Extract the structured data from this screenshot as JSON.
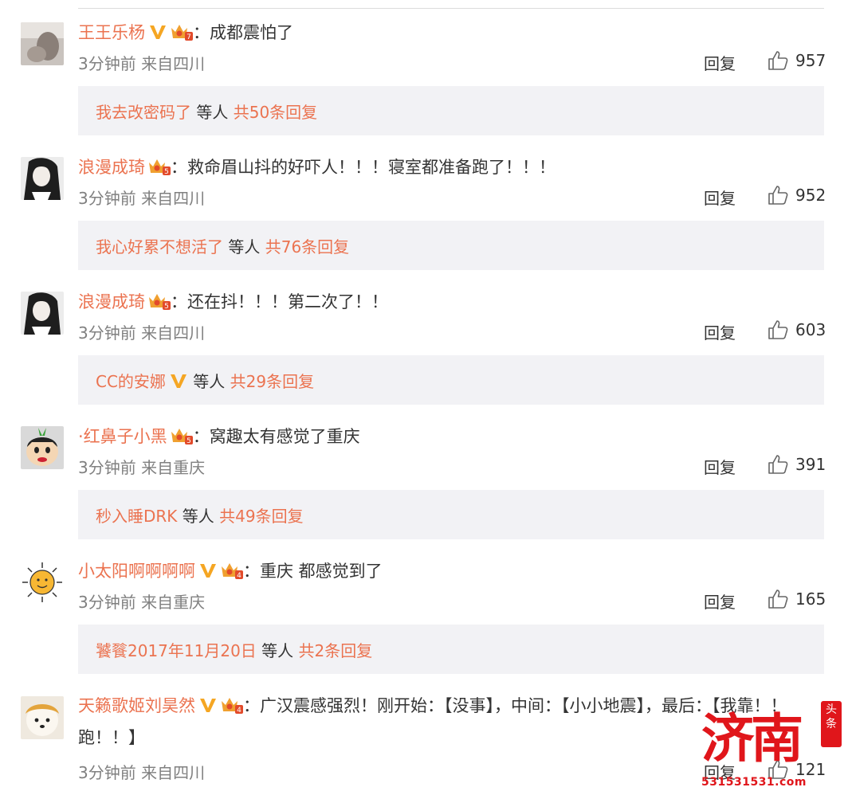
{
  "colors": {
    "accent": "#eb7350",
    "text": "#333333",
    "meta": "#808080",
    "sub_bg": "#f2f2f5",
    "watermark": "#e0161b"
  },
  "labels": {
    "reply": "回复",
    "colon": "：",
    "sub_mid": " 等人 "
  },
  "comments": [
    {
      "user": "王王乐杨",
      "verified": true,
      "crown_level": "7",
      "text": "成都震怕了",
      "time": "3分钟前",
      "from": "来自四川",
      "likes": "957",
      "sub": {
        "user": "我去改密码了",
        "verified": false,
        "total": "共50条回复"
      }
    },
    {
      "user": "浪漫成琦",
      "verified": false,
      "crown_level": "5",
      "text": "救命眉山抖的好吓人！！！寝室都准备跑了！！！",
      "time": "3分钟前",
      "from": "来自四川",
      "likes": "952",
      "sub": {
        "user": "我心好累不想活了",
        "verified": false,
        "total": "共76条回复"
      }
    },
    {
      "user": "浪漫成琦",
      "verified": false,
      "crown_level": "5",
      "text": "还在抖！！！第二次了！！",
      "time": "3分钟前",
      "from": "来自四川",
      "likes": "603",
      "sub": {
        "user": "CC的安娜",
        "verified": true,
        "total": "共29条回复"
      }
    },
    {
      "user": "·红鼻子小黑",
      "verified": false,
      "crown_level": "5",
      "text": "窝趣太有感觉了重庆",
      "time": "3分钟前",
      "from": "来自重庆",
      "likes": "391",
      "sub": {
        "user": "秒入睡DRK",
        "verified": false,
        "total": "共49条回复"
      }
    },
    {
      "user": "小太阳啊啊啊啊",
      "verified": true,
      "crown_level": "4",
      "text": "重庆 都感觉到了",
      "time": "3分钟前",
      "from": "来自重庆",
      "likes": "165",
      "sub": {
        "user": "饕餮2017年11月20日",
        "verified": false,
        "total": "共2条回复"
      }
    },
    {
      "user": "天籁歌姬刘昊然",
      "verified": true,
      "crown_level": "4",
      "text": "广汉震感强烈！刚开始：【没事】，中间：【小小地震】，最后：【我靠！！跑！！】",
      "time": "3分钟前",
      "from": "来自四川",
      "likes": "121"
    }
  ],
  "watermark": {
    "text": "济南",
    "tag": "头条",
    "number": "531531531.com"
  }
}
